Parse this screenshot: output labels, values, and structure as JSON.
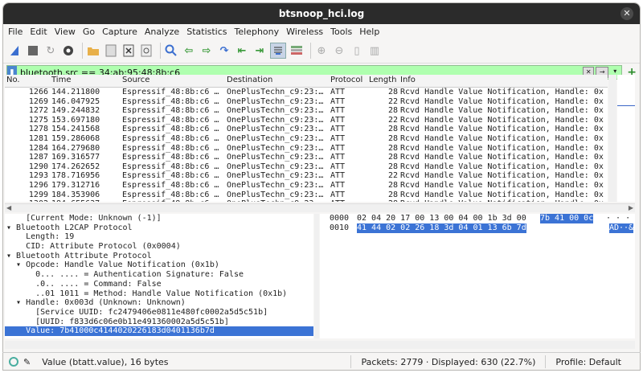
{
  "window": {
    "title": "btsnoop_hci.log"
  },
  "menu": [
    "File",
    "Edit",
    "View",
    "Go",
    "Capture",
    "Analyze",
    "Statistics",
    "Telephony",
    "Wireless",
    "Tools",
    "Help"
  ],
  "filter": {
    "value": "bluetooth.src == 34:ab:95:48:8b:c6"
  },
  "columns": {
    "no": "No.",
    "time": "Time",
    "source": "Source",
    "destination": "Destination",
    "protocol": "Protocol",
    "length": "Length",
    "info": "Info"
  },
  "packets": [
    {
      "no": "1266",
      "time": "144.211800",
      "src": "Espressif_48:8b:c6 …",
      "dst": "OnePlusTechn_c9:23:…",
      "proto": "ATT",
      "len": "28",
      "info": "Rcvd Handle Value Notification, Handle: 0x"
    },
    {
      "no": "1269",
      "time": "146.047925",
      "src": "Espressif_48:8b:c6 …",
      "dst": "OnePlusTechn_c9:23:…",
      "proto": "ATT",
      "len": "22",
      "info": "Rcvd Handle Value Notification, Handle: 0x"
    },
    {
      "no": "1272",
      "time": "149.244832",
      "src": "Espressif_48:8b:c6 …",
      "dst": "OnePlusTechn_c9:23:…",
      "proto": "ATT",
      "len": "28",
      "info": "Rcvd Handle Value Notification, Handle: 0x"
    },
    {
      "no": "1275",
      "time": "153.697180",
      "src": "Espressif_48:8b:c6 …",
      "dst": "OnePlusTechn_c9:23:…",
      "proto": "ATT",
      "len": "22",
      "info": "Rcvd Handle Value Notification, Handle: 0x"
    },
    {
      "no": "1278",
      "time": "154.241568",
      "src": "Espressif_48:8b:c6 …",
      "dst": "OnePlusTechn_c9:23:…",
      "proto": "ATT",
      "len": "28",
      "info": "Rcvd Handle Value Notification, Handle: 0x"
    },
    {
      "no": "1281",
      "time": "159.286068",
      "src": "Espressif_48:8b:c6 …",
      "dst": "OnePlusTechn_c9:23:…",
      "proto": "ATT",
      "len": "28",
      "info": "Rcvd Handle Value Notification, Handle: 0x"
    },
    {
      "no": "1284",
      "time": "164.279680",
      "src": "Espressif_48:8b:c6 …",
      "dst": "OnePlusTechn_c9:23:…",
      "proto": "ATT",
      "len": "28",
      "info": "Rcvd Handle Value Notification, Handle: 0x"
    },
    {
      "no": "1287",
      "time": "169.316577",
      "src": "Espressif_48:8b:c6 …",
      "dst": "OnePlusTechn_c9:23:…",
      "proto": "ATT",
      "len": "28",
      "info": "Rcvd Handle Value Notification, Handle: 0x"
    },
    {
      "no": "1290",
      "time": "174.262652",
      "src": "Espressif_48:8b:c6 …",
      "dst": "OnePlusTechn_c9:23:…",
      "proto": "ATT",
      "len": "28",
      "info": "Rcvd Handle Value Notification, Handle: 0x"
    },
    {
      "no": "1293",
      "time": "178.716956",
      "src": "Espressif_48:8b:c6 …",
      "dst": "OnePlusTechn_c9:23:…",
      "proto": "ATT",
      "len": "22",
      "info": "Rcvd Handle Value Notification, Handle: 0x"
    },
    {
      "no": "1296",
      "time": "179.312716",
      "src": "Espressif_48:8b:c6 …",
      "dst": "OnePlusTechn_c9:23:…",
      "proto": "ATT",
      "len": "28",
      "info": "Rcvd Handle Value Notification, Handle: 0x"
    },
    {
      "no": "1299",
      "time": "184.353906",
      "src": "Espressif_48:8b:c6 …",
      "dst": "OnePlusTechn_c9:23:…",
      "proto": "ATT",
      "len": "28",
      "info": "Rcvd Handle Value Notification, Handle: 0x"
    },
    {
      "no": "1302",
      "time": "184.655637",
      "src": "Espressif_48:8b:c6 …",
      "dst": "OnePlusTechn_c9:23:…",
      "proto": "ATT",
      "len": "28",
      "info": "Rcvd Handle Value Notification, Handle: 0x"
    }
  ],
  "details": [
    {
      "text": "    [Current Mode: Unknown (-1)]"
    },
    {
      "text": "▾ Bluetooth L2CAP Protocol"
    },
    {
      "text": "    Length: 19"
    },
    {
      "text": "    CID: Attribute Protocol (0x0004)"
    },
    {
      "text": "▾ Bluetooth Attribute Protocol"
    },
    {
      "text": "  ▾ Opcode: Handle Value Notification (0x1b)"
    },
    {
      "text": "      0... .... = Authentication Signature: False"
    },
    {
      "text": "      .0.. .... = Command: False"
    },
    {
      "text": "      ..01 1011 = Method: Handle Value Notification (0x1b)"
    },
    {
      "text": "  ▾ Handle: 0x003d (Unknown: Unknown)"
    },
    {
      "text": "      [Service UUID: fc2479406e0811e480fc0002a5d5c51b]"
    },
    {
      "text": "      [UUID: f833d6c06e0b11e491360002a5d5c51b]"
    },
    {
      "text": "    Value: 7b41000c4144020226183d0401136b7d"
    }
  ],
  "bytes": [
    {
      "offset": "0000",
      "hex1": "02 04 20 17 00 13 00 04  00 1b 3d 00",
      "hex2": "7b 41 00 0c",
      "ascii": "  · · ·"
    },
    {
      "offset": "0010",
      "hex1": "",
      "hex2": "41 44 02 02 26 18 3d 04  01 13 6b 7d",
      "ascii": "AD··&"
    }
  ],
  "status": {
    "field": "Value (btatt.value), 16 bytes",
    "packets": "Packets: 2779 · Displayed: 630 (22.7%)",
    "profile": "Profile: Default"
  }
}
